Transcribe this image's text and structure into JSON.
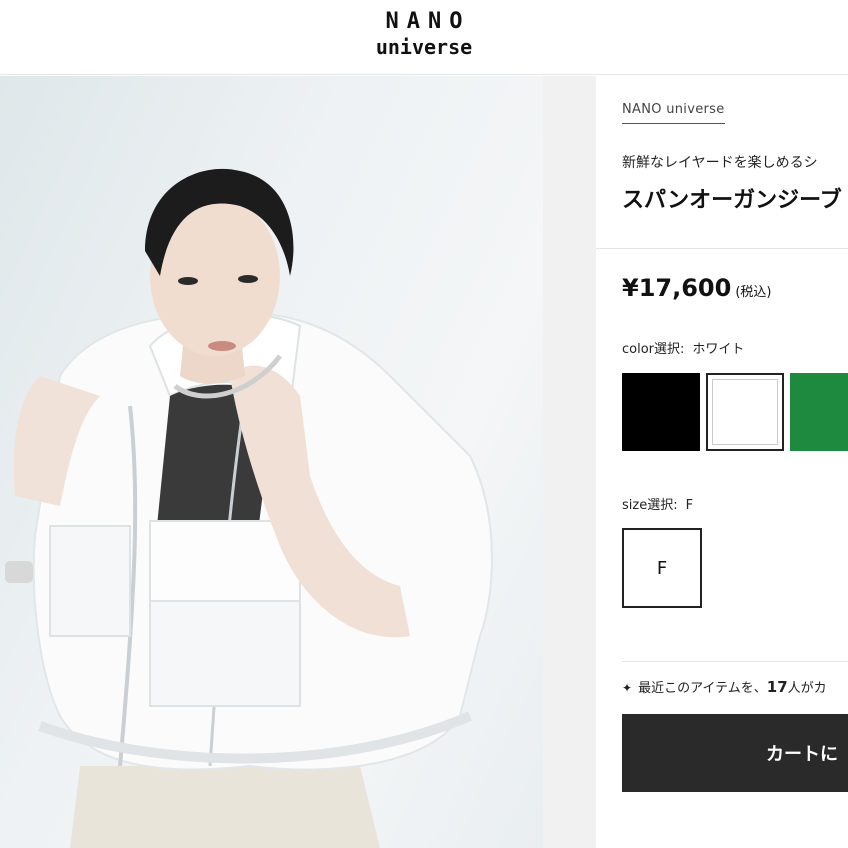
{
  "header": {
    "logo_line1": "NANO",
    "logo_line2": "universe"
  },
  "product": {
    "brand": "NANO universe",
    "catch_copy": "新鮮なレイヤードを楽しめるシ",
    "title": "スパンオーガンジーブ",
    "price": "¥17,600",
    "tax_label": "(税込)",
    "color_label": "color選択:",
    "color_value": "ホワイト",
    "colors": [
      {
        "name": "black",
        "hex": "#000000"
      },
      {
        "name": "white",
        "hex": "#ffffff",
        "selected": true
      },
      {
        "name": "green",
        "hex": "#1e8a3f"
      }
    ],
    "size_label": "size選択:",
    "size_value": "F",
    "sizes": [
      "F"
    ],
    "notice_prefix": "最近このアイテムを、",
    "notice_count": "17",
    "notice_suffix": "人がカ",
    "cart_button": "カートに"
  }
}
